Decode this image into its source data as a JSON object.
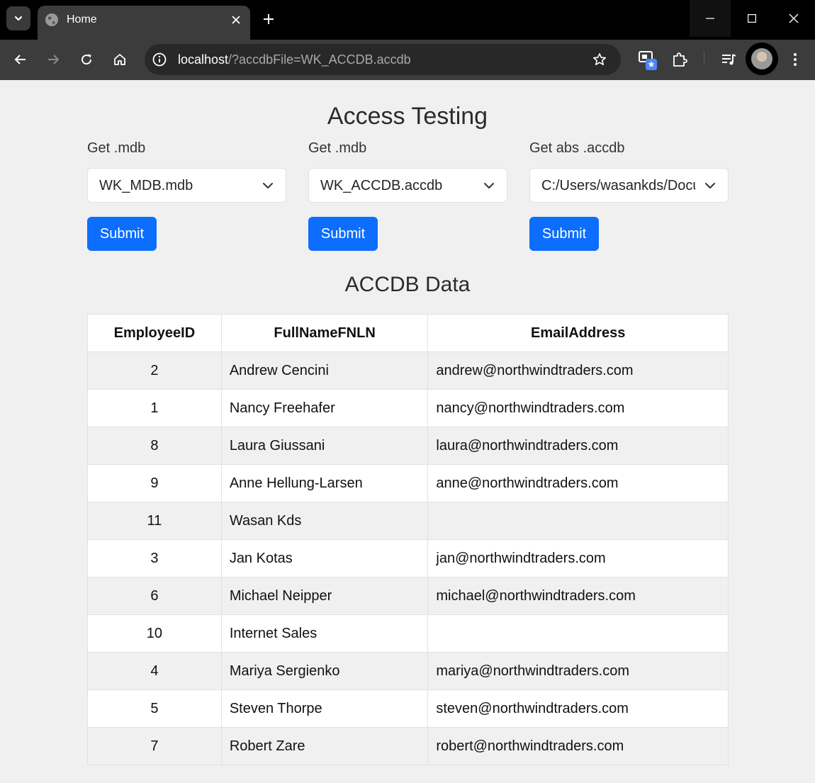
{
  "browser": {
    "tab_title": "Home",
    "url_host": "localhost",
    "url_rest": "/?accdbFile=WK_ACCDB.accdb"
  },
  "page": {
    "title": "Access Testing",
    "forms": [
      {
        "label": "Get .mdb",
        "selected": "WK_MDB.mdb",
        "submit": "Submit"
      },
      {
        "label": "Get .mdb",
        "selected": "WK_ACCDB.accdb",
        "submit": "Submit"
      },
      {
        "label": "Get abs .accdb",
        "selected": "C:/Users/wasankds/Documents",
        "submit": "Submit"
      }
    ],
    "section_title": "ACCDB Data",
    "table": {
      "headers": [
        "EmployeeID",
        "FullNameFNLN",
        "EmailAddress"
      ],
      "rows": [
        [
          "2",
          "Andrew Cencini",
          "andrew@northwindtraders.com"
        ],
        [
          "1",
          "Nancy Freehafer",
          "nancy@northwindtraders.com"
        ],
        [
          "8",
          "Laura Giussani",
          "laura@northwindtraders.com"
        ],
        [
          "9",
          "Anne Hellung-Larsen",
          "anne@northwindtraders.com"
        ],
        [
          "11",
          "Wasan Kds",
          ""
        ],
        [
          "3",
          "Jan Kotas",
          "jan@northwindtraders.com"
        ],
        [
          "6",
          "Michael Neipper",
          "michael@northwindtraders.com"
        ],
        [
          "10",
          "Internet Sales",
          ""
        ],
        [
          "4",
          "Mariya Sergienko",
          "mariya@northwindtraders.com"
        ],
        [
          "5",
          "Steven Thorpe",
          "steven@northwindtraders.com"
        ],
        [
          "7",
          "Robert Zare",
          "robert@northwindtraders.com"
        ]
      ]
    }
  }
}
